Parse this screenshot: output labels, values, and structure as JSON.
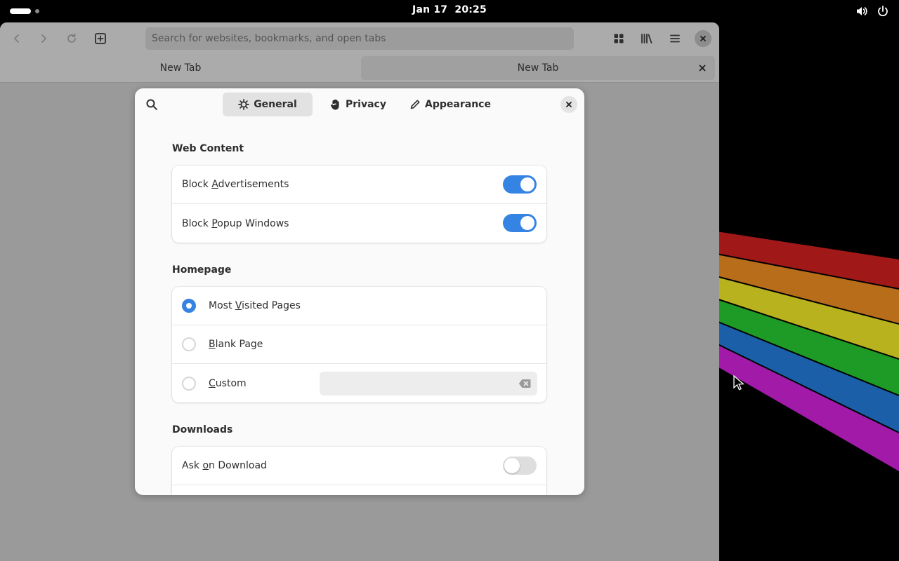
{
  "topbar": {
    "date": "Jan 17",
    "time": "20:25",
    "icons": [
      "volume-icon",
      "power-icon"
    ]
  },
  "browser": {
    "search_placeholder": "Search for websites, bookmarks, and open tabs",
    "tabs": [
      {
        "label": "New Tab"
      },
      {
        "label": "New Tab"
      }
    ]
  },
  "preferences": {
    "tabs": [
      {
        "label": "General",
        "icon": "gear-icon",
        "active": true
      },
      {
        "label": "Privacy",
        "icon": "hand-icon",
        "active": false
      },
      {
        "label": "Appearance",
        "icon": "pencil-icon",
        "active": false
      }
    ],
    "web_content": {
      "title": "Web Content",
      "block_ads": {
        "pre": "Block ",
        "mnemonic": "A",
        "post": "dvertisements",
        "value": true
      },
      "block_popups": {
        "pre": "Block ",
        "mnemonic": "P",
        "post": "opup Windows",
        "value": true
      }
    },
    "homepage": {
      "title": "Homepage",
      "most_visited": {
        "pre": "Most ",
        "mnemonic": "V",
        "post": "isited Pages",
        "selected": true
      },
      "blank_page": {
        "pre": "",
        "mnemonic": "B",
        "post": "lank Page",
        "selected": false
      },
      "custom": {
        "pre": "",
        "mnemonic": "C",
        "post": "ustom",
        "selected": false,
        "value": ""
      }
    },
    "downloads": {
      "title": "Downloads",
      "ask_on_download": {
        "pre": "Ask ",
        "mnemonic": "o",
        "post": "n Download",
        "value": false
      }
    }
  },
  "colors": {
    "accent": "#3584e4",
    "dim_backdrop": "#9a9a9a",
    "dialog_bg": "#fafafa"
  }
}
